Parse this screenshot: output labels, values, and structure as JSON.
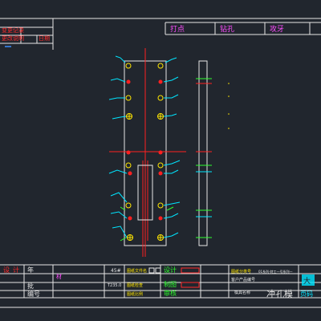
{
  "colors": {
    "background": "#21262e",
    "border": "#e6e6e6",
    "red_text": "#ff2a2a",
    "blue_text": "#3a8dff",
    "magenta_text": "#ff4dff",
    "cyan": "#00e5ff",
    "green": "#2dff2d",
    "yellow": "#ffe600",
    "red_line": "#ff2020"
  },
  "revision_table": {
    "row1": "变更记录",
    "row2_left": "更改说明",
    "row2_right": "日期"
  },
  "process_bar": {
    "items": [
      "打点",
      "钻孔",
      "攻牙"
    ]
  },
  "title_block": {
    "left_col": [
      "设",
      "计",
      "审",
      "核",
      "制",
      "图"
    ],
    "short_labels": [
      "年",
      "批",
      "编号"
    ],
    "material_value": "45#",
    "material_label": "材",
    "heat_treatment": "T235.0",
    "part_fields": [
      "图纸文件名",
      "图纸检查",
      "图纸比例"
    ],
    "design_labels": [
      "设计",
      "制图",
      "审核"
    ],
    "drawing_number_label": "图纸分类号",
    "drawing_number_value": "01系列-特工一号系列一",
    "customer_label": "客户产品编号",
    "customer_value": "",
    "product_name_label": "模具名称",
    "part_name": "冲孔模",
    "corner_labels": [
      "大",
      "页码"
    ]
  }
}
